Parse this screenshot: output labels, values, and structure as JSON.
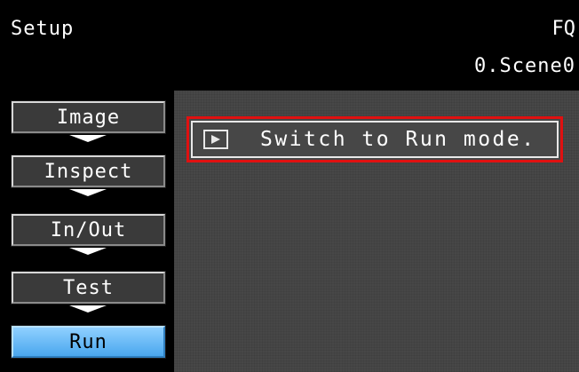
{
  "header": {
    "mode_title": "Setup",
    "device_name": "FQ",
    "scene_name": "0.Scene0"
  },
  "sidebar": {
    "items": [
      {
        "label": "Image",
        "active": false
      },
      {
        "label": "Inspect",
        "active": false
      },
      {
        "label": "In/Out",
        "active": false
      },
      {
        "label": "Test",
        "active": false
      },
      {
        "label": "Run",
        "active": true
      }
    ]
  },
  "main": {
    "run_switch_label": "Switch to Run mode.",
    "run_switch_icon": "play-icon"
  },
  "colors": {
    "background": "#000000",
    "panel": "#474747",
    "active_button": "#4aa7ee",
    "highlight_border": "#e01010",
    "text": "#ffffff"
  }
}
